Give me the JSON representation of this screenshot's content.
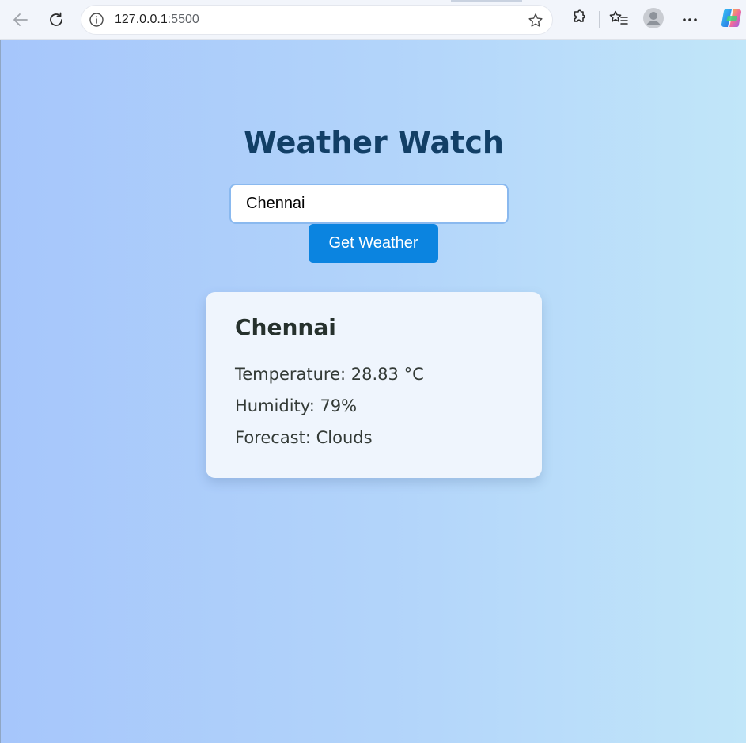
{
  "browser": {
    "address": {
      "host": "127.0.0.1",
      "port": ":5500"
    },
    "icons": [
      "back-arrow-icon",
      "reload-icon",
      "site-info-icon",
      "favorite-star-icon",
      "extensions-icon",
      "favorites-list-icon",
      "profile-avatar-icon",
      "more-menu-icon",
      "copilot-icon"
    ]
  },
  "app": {
    "title": "Weather Watch",
    "search": {
      "value": "Chennai",
      "button_label": "Get Weather"
    },
    "result": {
      "city": "Chennai",
      "temperature": "Temperature: 28.83 °C",
      "humidity": "Humidity: 79%",
      "forecast": "Forecast: Clouds"
    }
  },
  "colors": {
    "title": "#123f66",
    "button": "#0b84e0",
    "background_start": "#a6c6fb",
    "background_end": "#c1e6f9",
    "card": "#eff5fd"
  }
}
